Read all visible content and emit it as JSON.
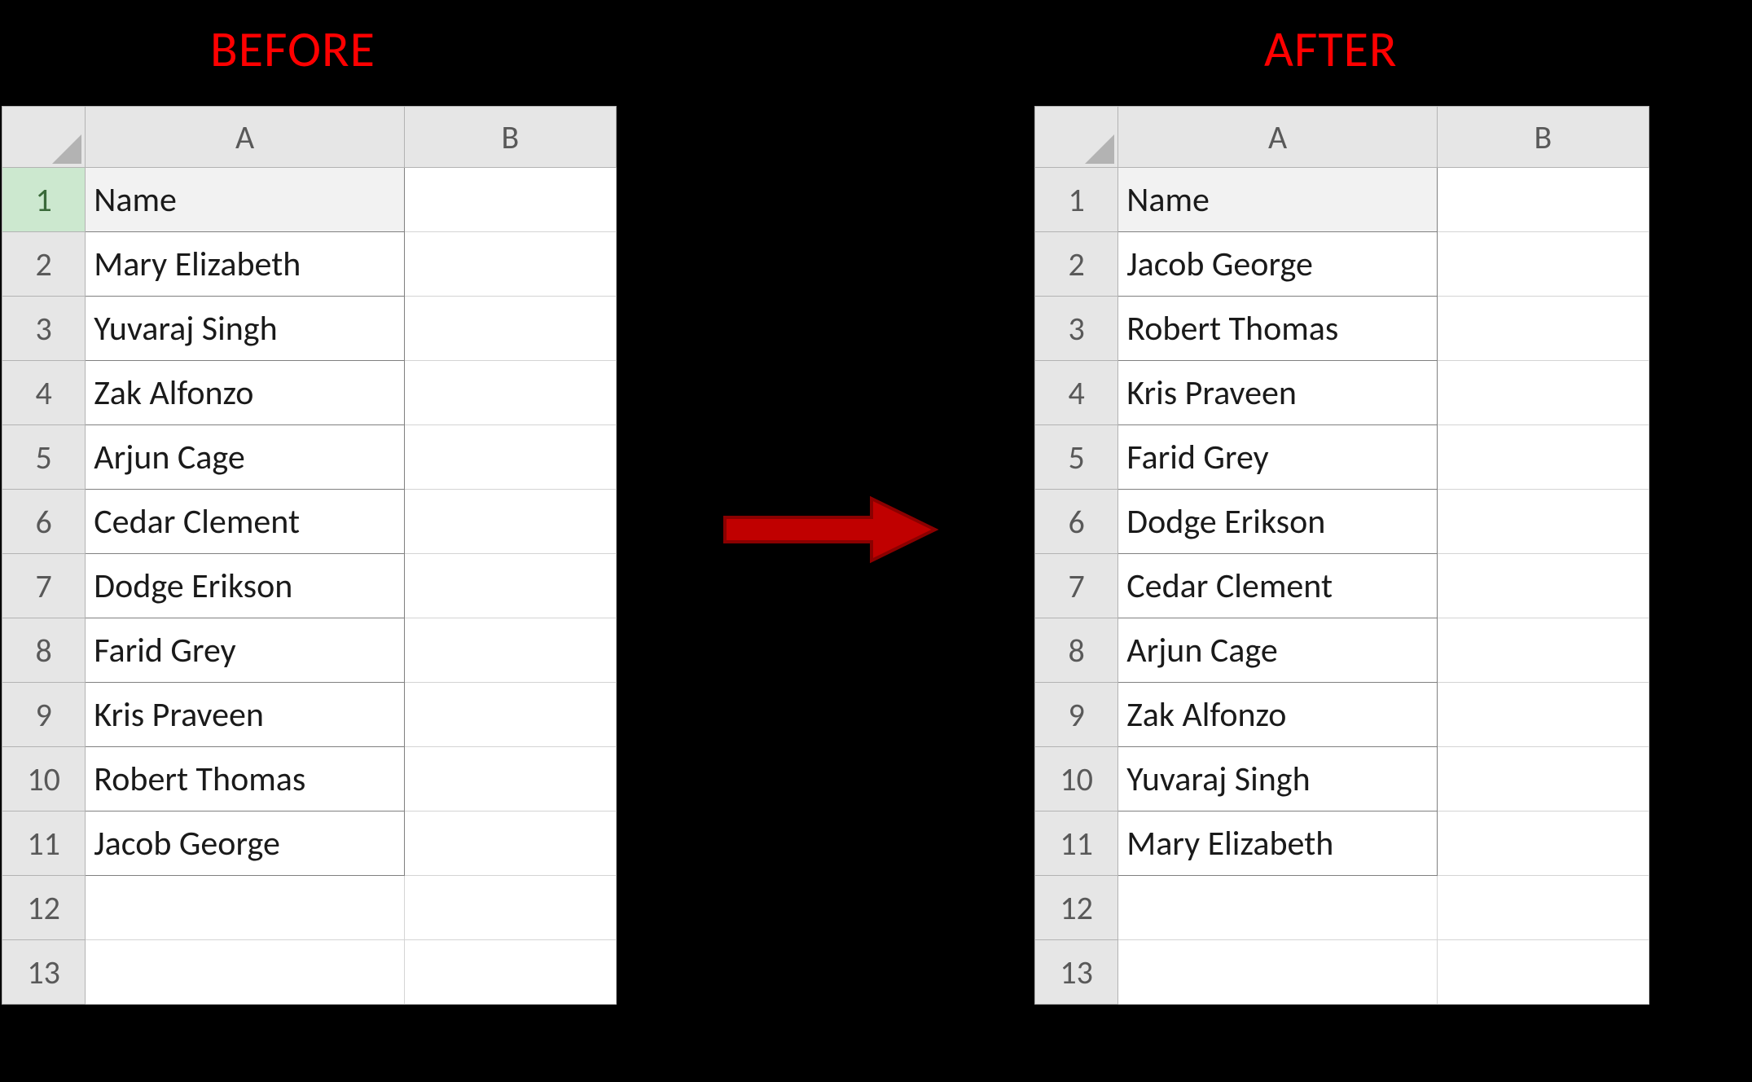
{
  "titles": {
    "before": "BEFORE",
    "after": "AFTER"
  },
  "columns": [
    "A",
    "B"
  ],
  "row_numbers_visible": [
    1,
    2,
    3,
    4,
    5,
    6,
    7,
    8,
    9,
    10,
    11,
    12,
    13
  ],
  "before": {
    "header_label": "Name",
    "names": [
      "Mary Elizabeth",
      "Yuvaraj Singh",
      "Zak Alfonzo",
      "Arjun Cage",
      "Cedar Clement",
      "Dodge Erikson",
      "Farid Grey",
      "Kris Praveen",
      "Robert Thomas",
      "Jacob George"
    ],
    "active_cell_row": 1
  },
  "after": {
    "header_label": "Name",
    "names": [
      "Jacob George",
      "Robert Thomas",
      "Kris Praveen",
      "Farid Grey",
      "Dodge Erikson",
      "Cedar Clement",
      "Arjun Cage",
      "Zak Alfonzo",
      "Yuvaraj Singh",
      "Mary Elizabeth"
    ]
  },
  "colors": {
    "title": "#ff0000",
    "arrow": "#c00000",
    "bg": "#000000"
  }
}
